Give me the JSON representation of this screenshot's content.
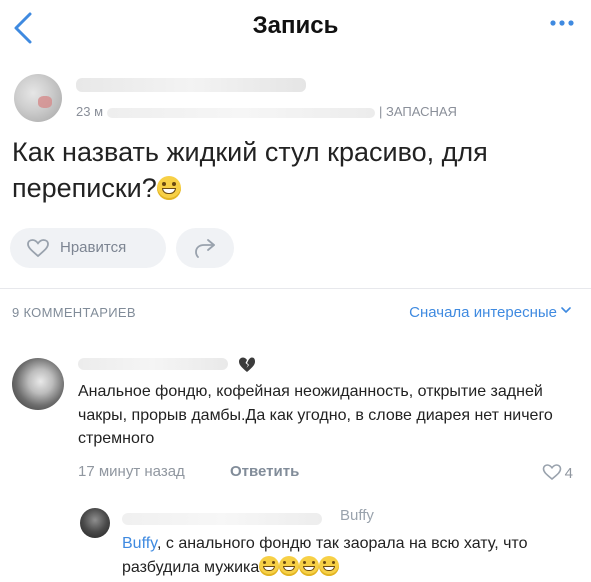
{
  "header": {
    "title": "Запись",
    "back_icon": "chevron-left-icon",
    "more_icon": "more-horizontal-icon",
    "accent": "#3f8ae0"
  },
  "post": {
    "time": "23 м",
    "source": "| ЗАПАСНАЯ",
    "text": "Как назвать жидкий стул красиво, для переписки?",
    "like_label": "Нравится"
  },
  "comments": {
    "count_label": "9 КОММЕНТАРИЕВ",
    "sort_label": "Сначала интересные",
    "items": [
      {
        "text": "Анальное фондю, кофейная неожиданность, открытие задней чакры, прорыв дамбы.Да как угодно, в слове диарея нет ничего стремного",
        "time": "17 минут назад",
        "reply_label": "Ответить",
        "likes": "4"
      }
    ],
    "reply": {
      "reply_to": "Buffy",
      "mention": "Buffy",
      "text": ", с анального фондю так заорала на всю хату, что разбудила мужика"
    }
  }
}
